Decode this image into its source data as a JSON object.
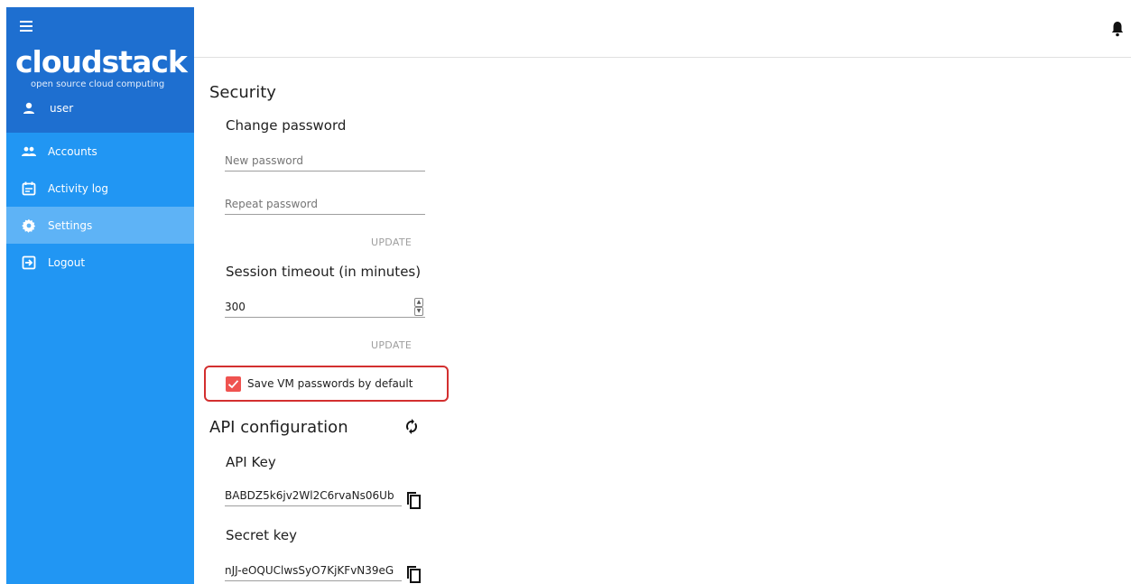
{
  "sidebar": {
    "logo": "cloudstack",
    "tagline": "open source cloud computing",
    "user": "user",
    "items": [
      {
        "label": "Accounts",
        "icon": "accounts-icon"
      },
      {
        "label": "Activity log",
        "icon": "calendar-icon"
      },
      {
        "label": "Settings",
        "icon": "gear-icon",
        "active": true
      },
      {
        "label": "Logout",
        "icon": "logout-icon"
      }
    ]
  },
  "security": {
    "title": "Security",
    "change_password": {
      "title": "Change password",
      "new_placeholder": "New password",
      "repeat_placeholder": "Repeat password",
      "update_label": "UPDATE"
    },
    "session_timeout": {
      "title": "Session timeout (in minutes)",
      "value": "300",
      "update_label": "UPDATE"
    },
    "save_vm_passwords": {
      "label": "Save VM passwords by default",
      "checked": true
    }
  },
  "api": {
    "title": "API configuration",
    "api_key_label": "API Key",
    "api_key": "BABDZ5k6jv2Wl2C6rvaNs06Ub",
    "secret_key_label": "Secret key",
    "secret_key": "nJJ-eOQUClwsSyO7KjKFvN39eG"
  },
  "colors": {
    "sidebar": "#2196f3",
    "sidebar_header": "#1e6fd0",
    "active_item": "#5eb3f6",
    "checkbox": "#ef5350",
    "highlight": "#d32f2f"
  }
}
